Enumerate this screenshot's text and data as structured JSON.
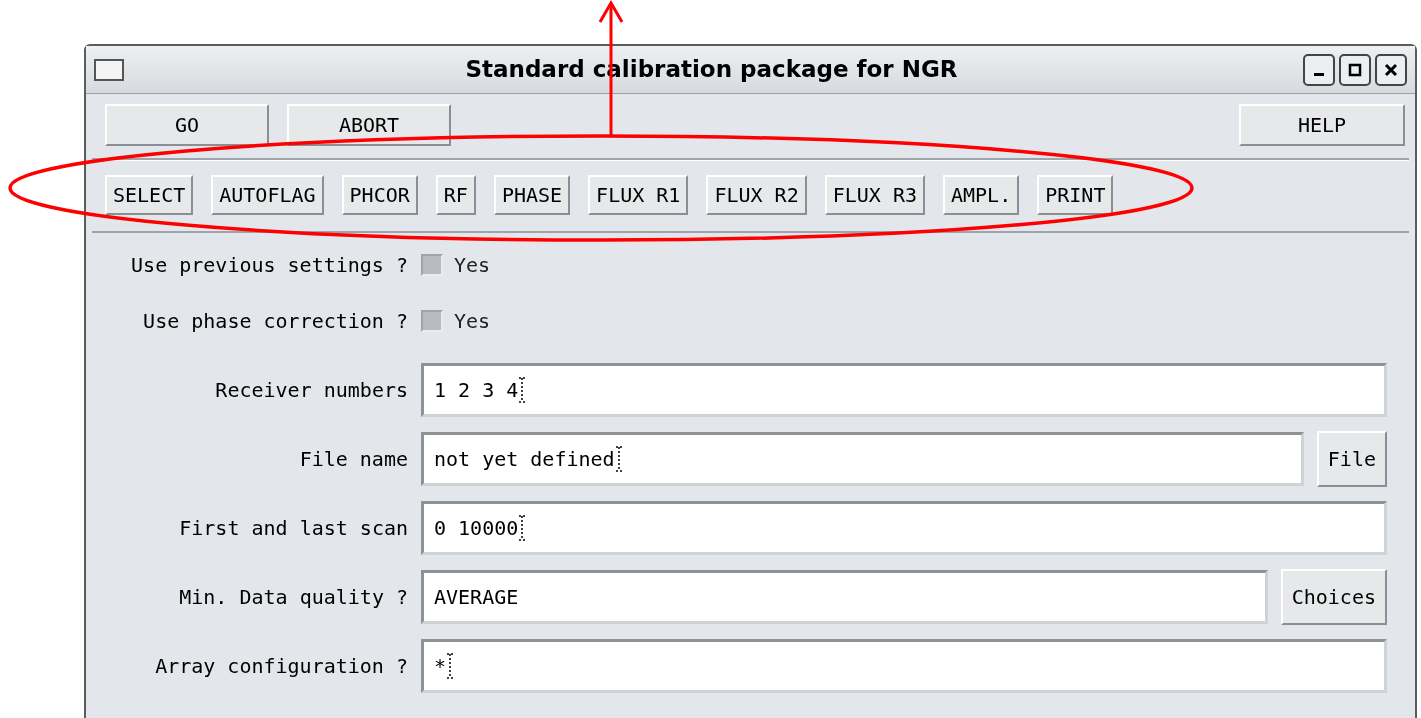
{
  "window": {
    "title": "Standard calibration package for NGR"
  },
  "title_buttons": [
    {
      "kind": "minimize"
    },
    {
      "kind": "maximize"
    },
    {
      "kind": "close"
    }
  ],
  "top_buttons": [
    {
      "label": "GO"
    },
    {
      "label": "ABORT"
    }
  ],
  "help_button": {
    "label": "HELP"
  },
  "tool_buttons": [
    {
      "label": "SELECT"
    },
    {
      "label": "AUTOFLAG"
    },
    {
      "label": "PHCOR"
    },
    {
      "label": "RF"
    },
    {
      "label": "PHASE"
    },
    {
      "label": "FLUX R1"
    },
    {
      "label": "FLUX R2"
    },
    {
      "label": "FLUX R3"
    },
    {
      "label": "AMPL."
    },
    {
      "label": "PRINT"
    }
  ],
  "form": [
    {
      "kind": "checkbox",
      "label": "Use previous settings ?",
      "option": "Yes",
      "disabled": true
    },
    {
      "kind": "checkbox",
      "label": "Use phase correction ?",
      "option": "Yes",
      "disabled": true
    },
    {
      "kind": "text",
      "label": "Receiver numbers",
      "value": "1 2 3 4",
      "cursor": true
    },
    {
      "kind": "text",
      "label": "File name",
      "value": "not yet defined",
      "cursor": true,
      "button": "File"
    },
    {
      "kind": "text",
      "label": "First and last scan",
      "value": "0 10000",
      "cursor": true
    },
    {
      "kind": "text",
      "label": "Min. Data quality ?",
      "value": "AVERAGE",
      "cursor": false,
      "button": "Choices"
    },
    {
      "kind": "text",
      "label": "Array configuration ?",
      "value": "*",
      "cursor": true
    }
  ]
}
